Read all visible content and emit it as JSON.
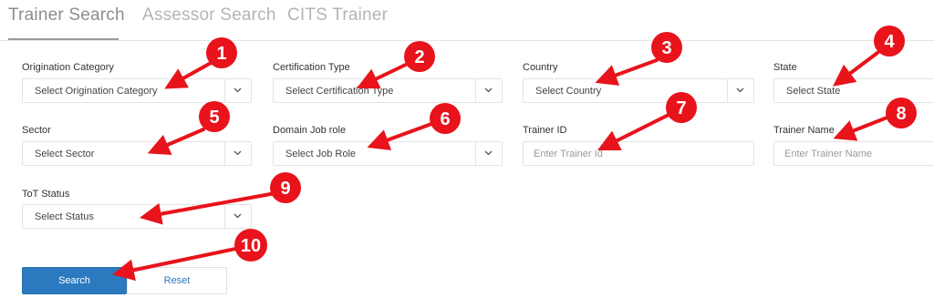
{
  "tabs": [
    {
      "label": "Trainer Search",
      "active": true
    },
    {
      "label": "Assessor Search",
      "active": false
    },
    {
      "label": "CITS Trainer",
      "active": false
    }
  ],
  "fields": {
    "origination_category": {
      "label": "Origination Category",
      "value": "Select Origination Category"
    },
    "certification_type": {
      "label": "Certification Type",
      "value": "Select Certification Type"
    },
    "country": {
      "label": "Country",
      "value": "Select Country"
    },
    "state": {
      "label": "State",
      "value": "Select State"
    },
    "sector": {
      "label": "Sector",
      "value": "Select Sector"
    },
    "domain_job_role": {
      "label": "Domain Job role",
      "value": "Select Job Role"
    },
    "trainer_id": {
      "label": "Trainer ID",
      "placeholder": "Enter Trainer Id"
    },
    "trainer_name": {
      "label": "Trainer Name",
      "placeholder": "Enter Trainer Name"
    },
    "tot_status": {
      "label": "ToT Status",
      "value": "Select Status"
    }
  },
  "buttons": {
    "search": "Search",
    "reset": "Reset"
  },
  "annotations": [
    "1",
    "2",
    "3",
    "4",
    "5",
    "6",
    "7",
    "8",
    "9",
    "10"
  ],
  "colors": {
    "primary": "#2b7abf",
    "annotation_red": "#e8131b"
  },
  "icons": {
    "dropdown": "chevron-down-icon",
    "annotation": "numbered-badge"
  }
}
